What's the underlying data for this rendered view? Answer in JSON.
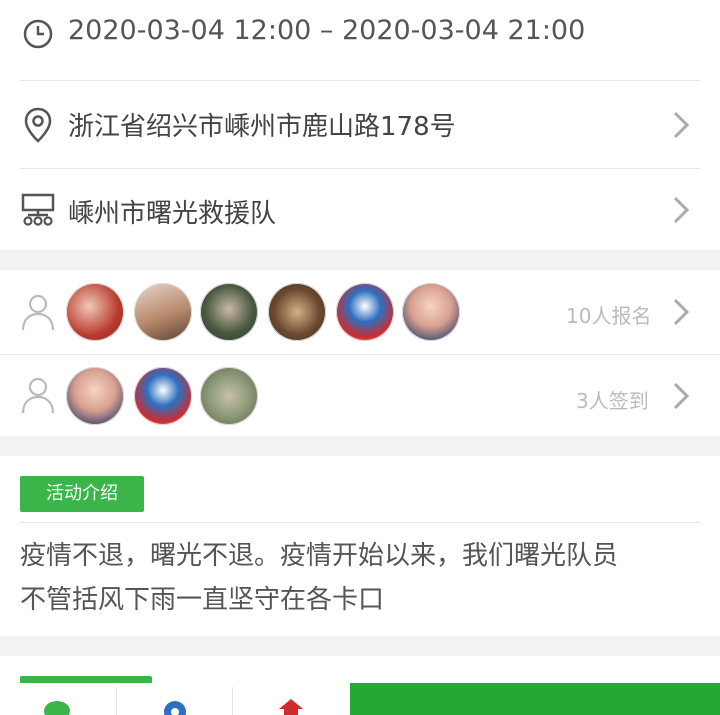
{
  "event": {
    "time_range": "2020-03-04 12:00 – 2020-03-04 21:00",
    "address": "浙江省绍兴市嵊州市鹿山路178号",
    "organizer": "嵊州市曙光救援队"
  },
  "participants": {
    "signup_count_label": "10人报名",
    "checkin_count_label": "3人签到"
  },
  "intro": {
    "tag_label": "活动介绍",
    "text_line1": "疫情不退，曙光不退。疫情开始以来，我们曙光队员",
    "text_line2": "不管括风下雨一直坚守在各卡口"
  },
  "colors": {
    "accent_green": "#25a935",
    "tag_green": "#3bb44a"
  },
  "icons": [
    "clock-icon",
    "location-icon",
    "organization-icon",
    "person-icon",
    "chevron-right-icon"
  ]
}
